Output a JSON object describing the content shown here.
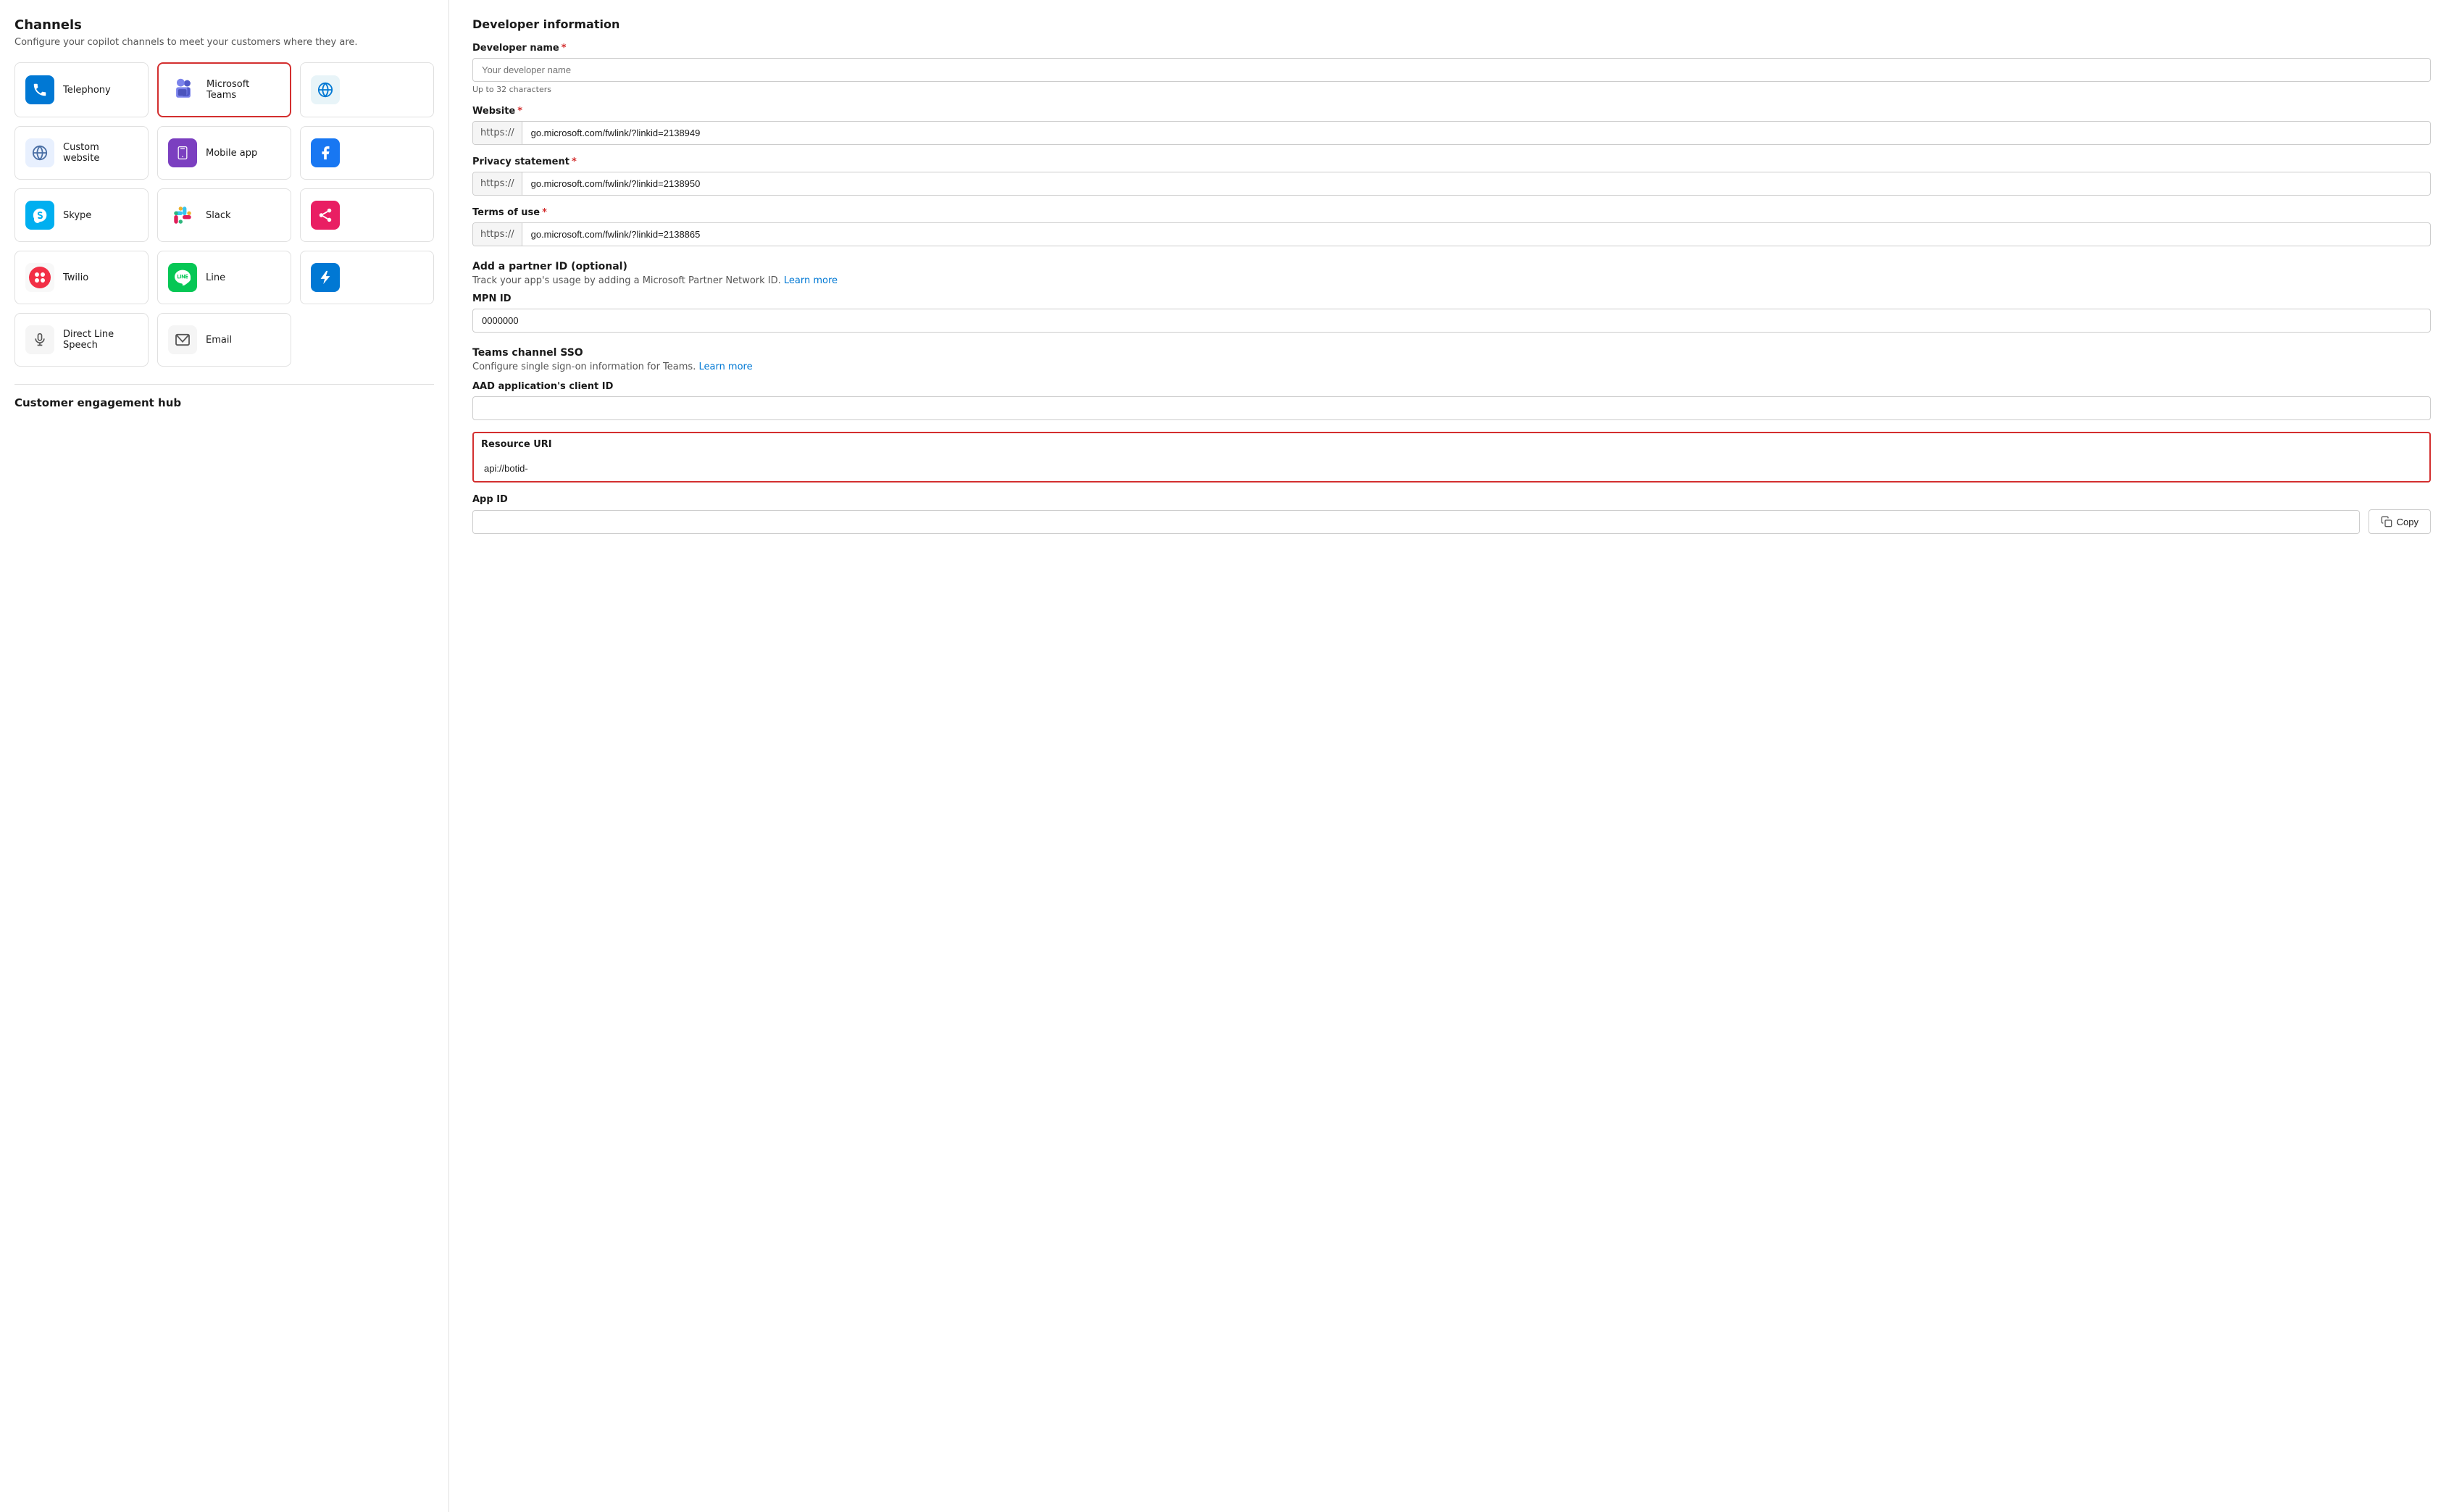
{
  "left": {
    "heading": "Channels",
    "subtitle": "Configure your copilot channels to meet your customers where they are.",
    "channels": [
      {
        "id": "telephony",
        "label": "Telephony",
        "icon_type": "telephony",
        "selected": false
      },
      {
        "id": "teams",
        "label": "Microsoft Teams",
        "icon_type": "teams",
        "selected": true
      },
      {
        "id": "website",
        "label": "",
        "icon_type": "website",
        "selected": false,
        "partial": true
      },
      {
        "id": "custom_website",
        "label": "Custom website",
        "icon_type": "website",
        "selected": false
      },
      {
        "id": "mobile_app",
        "label": "Mobile app",
        "icon_type": "mobile",
        "selected": false
      },
      {
        "id": "fb",
        "label": "",
        "icon_type": "fb",
        "selected": false,
        "partial": true
      },
      {
        "id": "skype",
        "label": "Skype",
        "icon_type": "skype",
        "selected": false
      },
      {
        "id": "slack",
        "label": "Slack",
        "icon_type": "slack",
        "selected": false
      },
      {
        "id": "share2",
        "label": "",
        "icon_type": "share",
        "selected": false,
        "partial": true
      },
      {
        "id": "twilio",
        "label": "Twilio",
        "icon_type": "twilio",
        "selected": false
      },
      {
        "id": "line",
        "label": "Line",
        "icon_type": "line",
        "selected": false
      },
      {
        "id": "azure",
        "label": "",
        "icon_type": "azure",
        "selected": false,
        "partial": true
      },
      {
        "id": "speech",
        "label": "Direct Line Speech",
        "icon_type": "speech",
        "selected": false
      },
      {
        "id": "email",
        "label": "Email",
        "icon_type": "email",
        "selected": false
      }
    ],
    "customer_hub": "Customer engagement hub"
  },
  "right": {
    "section_title": "Developer information",
    "developer_name": {
      "label": "Developer name",
      "required": true,
      "placeholder": "Your developer name",
      "hint": "Up to 32 characters"
    },
    "website": {
      "label": "Website",
      "required": true,
      "prefix": "https://",
      "value": "go.microsoft.com/fwlink/?linkid=2138949"
    },
    "privacy_statement": {
      "label": "Privacy statement",
      "required": true,
      "prefix": "https://",
      "value": "go.microsoft.com/fwlink/?linkid=2138950"
    },
    "terms_of_use": {
      "label": "Terms of use",
      "required": true,
      "prefix": "https://",
      "value": "go.microsoft.com/fwlink/?linkid=2138865"
    },
    "partner": {
      "title": "Add a partner ID (optional)",
      "description": "Track your app's usage by adding a Microsoft Partner Network ID.",
      "learn_more": "Learn more",
      "mpn_label": "MPN ID",
      "mpn_value": "0000000"
    },
    "sso": {
      "title": "Teams channel SSO",
      "description": "Configure single sign-on information for Teams.",
      "learn_more": "Learn more",
      "aad_label": "AAD application's client ID",
      "aad_value": "",
      "resource_uri_label": "Resource URI",
      "resource_uri_value": "api://botid-",
      "app_id_label": "App ID",
      "app_id_value": "",
      "copy_label": "Copy"
    }
  }
}
